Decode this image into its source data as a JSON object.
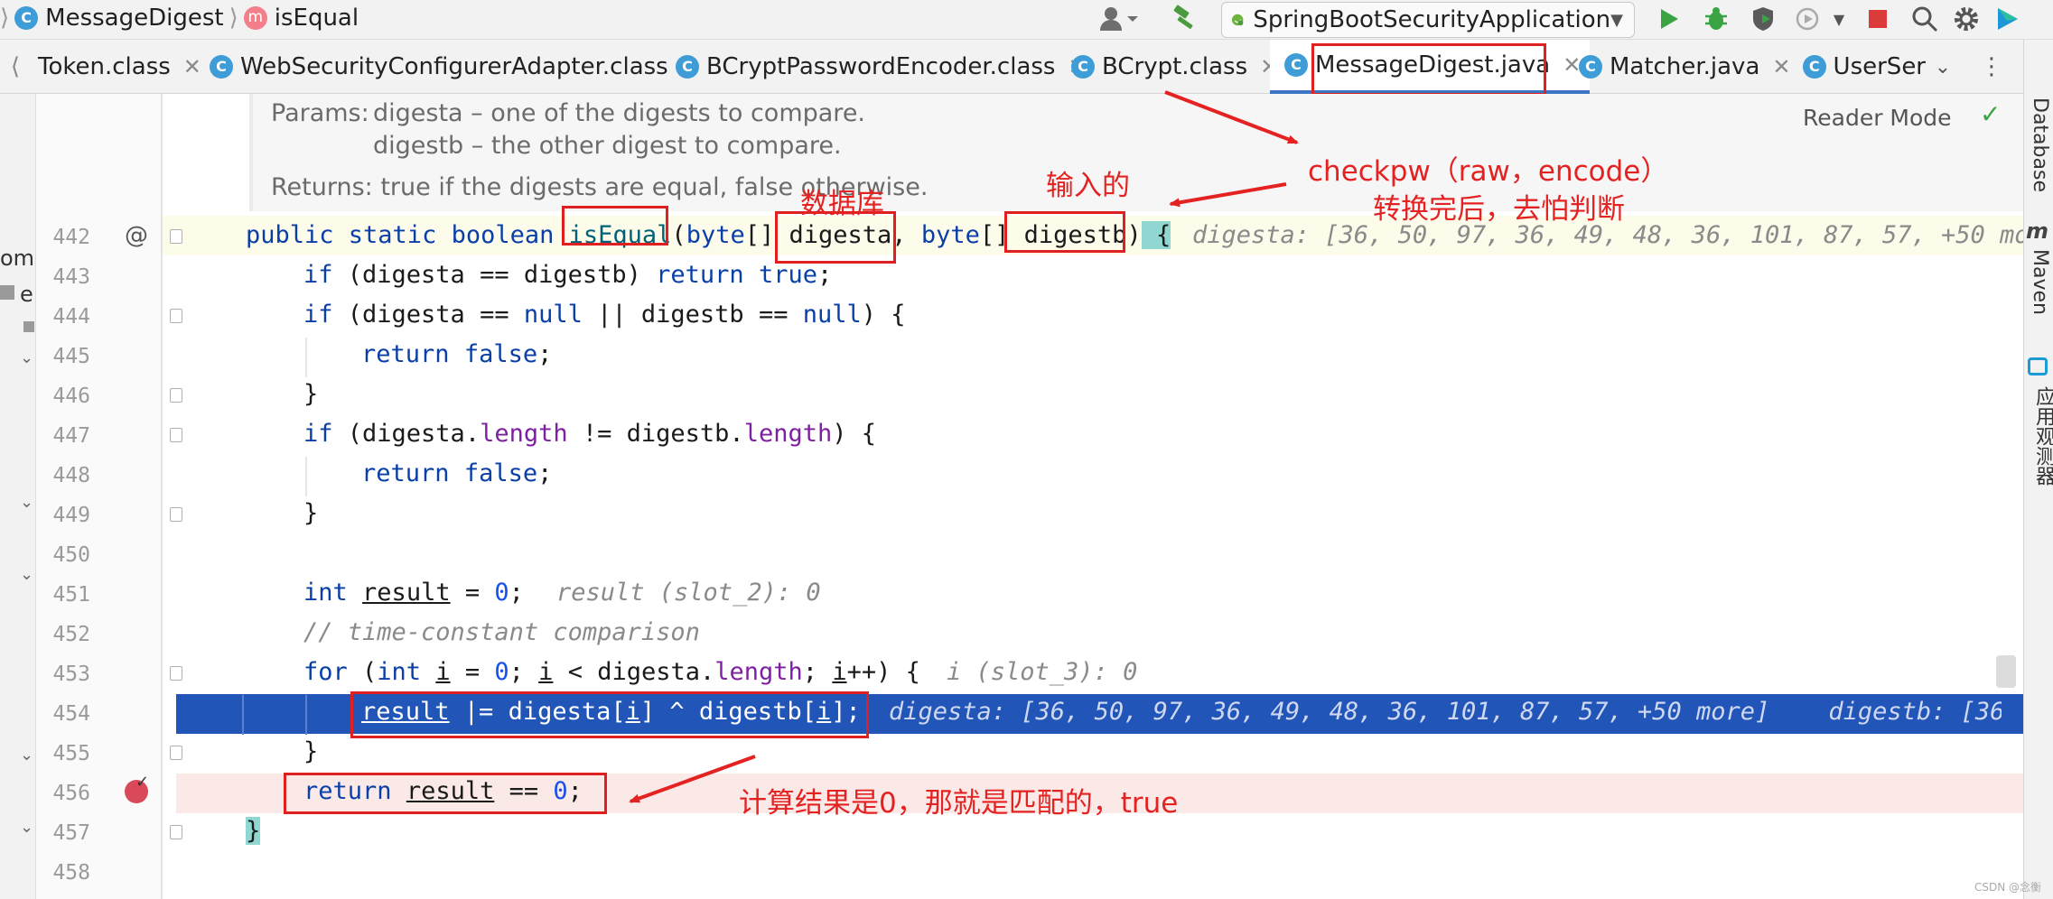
{
  "breadcrumb": {
    "class_name": "MessageDigest",
    "method_name": "isEqual",
    "class_badge": "C",
    "method_badge": "m"
  },
  "toolbar": {
    "run_config": "SpringBootSecurityApplication"
  },
  "tabs": [
    {
      "label": "Token.class",
      "badge": ""
    },
    {
      "label": "WebSecurityConfigurerAdapter.class",
      "badge": "C"
    },
    {
      "label": "BCryptPasswordEncoder.class",
      "badge": "C"
    },
    {
      "label": "BCrypt.class",
      "badge": "C"
    },
    {
      "label": "MessageDigest.java",
      "badge": "C"
    },
    {
      "label": "Matcher.java",
      "badge": "C"
    },
    {
      "label": "UserSer",
      "badge": "C"
    }
  ],
  "right_tools": {
    "database": "Database",
    "maven": "Maven",
    "maven_badge": "m",
    "observer": "应用观测器"
  },
  "reader_mode": "Reader Mode",
  "doc": {
    "params_label": "Params:",
    "param_a": "digesta – one of the digests to compare.",
    "param_b": "digestb – the other digest to compare.",
    "returns": "Returns: true if the digests are equal, false otherwise."
  },
  "line_numbers": [
    "442",
    "443",
    "444",
    "445",
    "446",
    "447",
    "448",
    "449",
    "450",
    "451",
    "452",
    "453",
    "454",
    "455",
    "456",
    "457",
    "458"
  ],
  "gutter_at": "@",
  "code": {
    "l442": {
      "kw1": "public static boolean ",
      "fn": "isEqual",
      "p1": "(",
      "kw2": "byte",
      "p2": "[] ",
      "a": "digesta",
      "comma": ",",
      "sp": " ",
      "kw3": "byte",
      "p3": "[] ",
      "b": "digestb",
      "p4": ")",
      "brace": " {",
      "hint": "digesta: [36, 50, 97, 36, 49, 48, 36, 101, 87, 57, +50 mo"
    },
    "l443": {
      "kw": "if",
      "t1": " (digesta == digestb) ",
      "kw2": "return",
      "sp": " ",
      "kw3": "true",
      "t2": ";"
    },
    "l444": {
      "kw": "if",
      "t1": " (digesta == ",
      "kw2": "null",
      "t2": " || digestb == ",
      "kw3": "null",
      "t3": ") {"
    },
    "l445": {
      "kw": "return",
      "sp": " ",
      "kw2": "false",
      "t": ";"
    },
    "l446": {
      "t": "}"
    },
    "l447": {
      "kw": "if",
      "t1": " (digesta.",
      "f": "length",
      "t2": " != digestb.",
      "f2": "length",
      "t3": ") {"
    },
    "l448": {
      "kw": "return",
      "sp": " ",
      "kw2": "false",
      "t": ";"
    },
    "l449": {
      "t": "}"
    },
    "l451": {
      "kw": "int",
      "sp": " ",
      "v": "result",
      "t": " = ",
      "n": "0",
      "e": ";",
      "hint": "result (slot_2): 0"
    },
    "l452": {
      "c": "// time-constant comparison"
    },
    "l453": {
      "kw": "for",
      "t1": " (",
      "kw2": "int",
      "sp": " ",
      "i1": "i",
      "t2": " = ",
      "n": "0",
      "t3": "; ",
      "i2": "i",
      "t4": " < digesta.",
      "f": "length",
      "t5": "; ",
      "i3": "i",
      "t6": "++) {",
      "hint": "i (slot_3): 0"
    },
    "l454": {
      "v": "result",
      "t1": " |= digesta[",
      "i1": "i",
      "t2": "] ^ digestb[",
      "i2": "i",
      "t3": "];",
      "hint": "digesta: [36, 50, 97, 36, 49, 48, 36, 101, 87, 57, +50 more]    digestb: [36,"
    },
    "l455": {
      "t": "}"
    },
    "l456": {
      "kw": "return",
      "sp": " ",
      "v": "result",
      "t": " == ",
      "n": "0",
      "e": ";"
    },
    "l457": {
      "t": "}"
    }
  },
  "annotations": {
    "db": "数据库",
    "input": "输入的",
    "checkpw": "checkpw（raw，encode）",
    "after_convert": "转换完后，去怕判断",
    "result_zero": "计算结果是0，那就是匹配的，true"
  },
  "left_strip": {
    "cut_1": "om",
    "cut_2": "e"
  },
  "colors": {
    "accent": "#3a76c4",
    "annotation": "#e42222",
    "exec_line": "#2155b8"
  },
  "watermark": "CSDN @念衡"
}
